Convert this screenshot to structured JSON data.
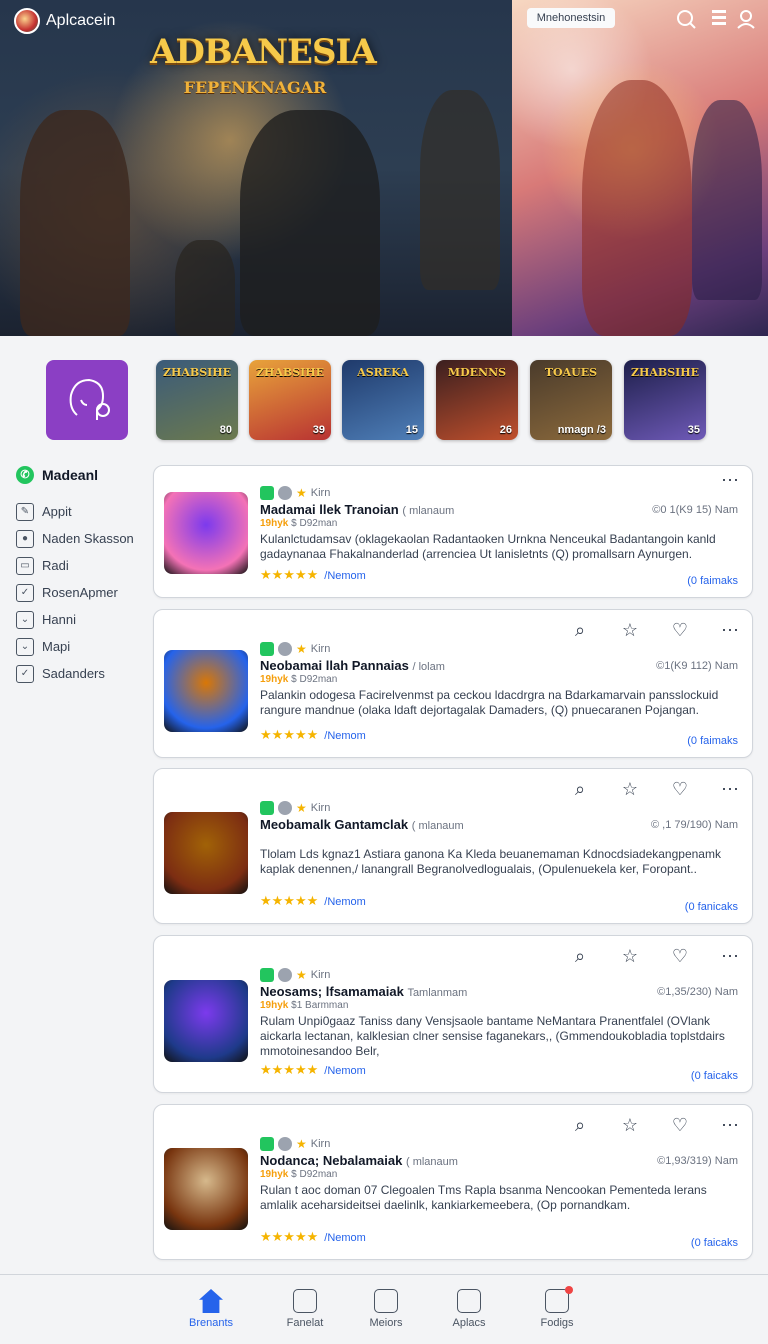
{
  "app": {
    "brand": "Aplcacein",
    "hero_chip": "Mnehonestsin"
  },
  "hero": {
    "title": "ADBANESIA",
    "subtitle": "FEPENKNAGAR"
  },
  "featured": [
    {
      "label": "ZHABSIHE",
      "count": "80",
      "colors": [
        "#3b5b7a",
        "#6c7a4e"
      ]
    },
    {
      "label": "ZHABSIHE",
      "count": "39",
      "colors": [
        "#e8a33b",
        "#b83232"
      ]
    },
    {
      "label": "ASREKA",
      "count": "15",
      "colors": [
        "#1f3a6b",
        "#4f7fb8"
      ]
    },
    {
      "label": "MDENNS",
      "count": "26",
      "colors": [
        "#3b1f1f",
        "#c0502d"
      ]
    },
    {
      "label": "TOAUES",
      "count": "nmagn /3",
      "colors": [
        "#4a3b2b",
        "#8c6a3c"
      ]
    },
    {
      "label": "ZHABSIHE",
      "count": "35",
      "colors": [
        "#1d1f4a",
        "#6f5ab8"
      ]
    }
  ],
  "sidebar": {
    "title": "Madeanl",
    "items": [
      {
        "label": "Appit",
        "icon": "pencil-icon"
      },
      {
        "label": "Naden Skasson",
        "icon": "circle-dot-icon"
      },
      {
        "label": "Radi",
        "icon": "square-icon"
      },
      {
        "label": "RosenApmer",
        "icon": "check-icon"
      },
      {
        "label": "Hanni",
        "icon": "chevron-down-icon"
      },
      {
        "label": "Mapi",
        "icon": "chevron-down-icon"
      },
      {
        "label": "Sadanders",
        "icon": "check-icon"
      }
    ]
  },
  "cards": [
    {
      "meta": "Kirn",
      "title": "Madamai llek Tranoian",
      "title_sub": "( mlanaum",
      "right_meta": "©0 1(K9 15) Nam",
      "line2_hl": "19hyk",
      "line2": "$ D92man",
      "desc": "Kulanlctudamsav (oklagekaolan Radantaoken Urnkna Nenceukal Badantangoin kanld gadaynanaa Fhakalnanderlad (arrenciea Ut lanisletnts (Q) promallsarn Aynurgen.",
      "stars": "★★★★★",
      "stars_label": "/Nemom",
      "link": "(0 faimaks",
      "colors": [
        "#f472b6",
        "#7c3aed"
      ]
    },
    {
      "meta": "Kirn",
      "title": "Neobamai llah Pannaias",
      "title_sub": "/ lolam",
      "right_meta": "©1(K9 112) Nam",
      "line2_hl": "19hyk",
      "line2": "$ D92man",
      "desc": "Palankin odogesa Facirelvenmst pa ceckou ldacdrgra na Bdarkamarvain pansslockuid rangure mandnue (olaka ldaft dejortagalak Damaders, (Q) pnuecaranen Pojangan.",
      "stars": "★★★★★",
      "stars_label": "/Nemom",
      "link": "(0 faimaks",
      "colors": [
        "#2563eb",
        "#d97706"
      ]
    },
    {
      "meta": "Kirn",
      "title": "Meobamalk Gantamclak",
      "title_sub": "( mlanaum",
      "right_meta": "© ,1 79/190) Nam",
      "line2_hl": "",
      "line2": "",
      "desc": "Tlolam Lds kgnaz1 Astiara ganona Ka Kleda beuanemaman Kdnocdsiadekangpenamk kaplak denennen,/ lanangrall Begranolvedlogualais, (Opulenuekela ker, Foropant..",
      "stars": "★★★★★",
      "stars_label": "/Nemom",
      "link": "(0 fanicaks",
      "colors": [
        "#7c2d12",
        "#a16207"
      ]
    },
    {
      "meta": "Kirn",
      "title": "Neosams; lfsamamaiak",
      "title_sub": "Tamlanmam",
      "right_meta": "©1,35/230) Nam",
      "line2_hl": "19hyk",
      "line2": "$1 Barmman",
      "desc": "Rulam Unpi0gaaz Taniss dany Vensjsaole bantame NeMantara Pranentfalel (OVlank aickarla lectanan, kalklesian clner sensise faganekars,, (Gmmendoukobladia toplstdairs mmotoinesandoo Belr,",
      "stars": "★★★★★",
      "stars_label": "/Nemom",
      "link": "(0 faicaks",
      "colors": [
        "#1e3a8a",
        "#7c3aed"
      ]
    },
    {
      "meta": "Kirn",
      "title": "Nodanca; Nebalamaiak",
      "title_sub": "( mlanaum",
      "right_meta": "©1,93/319) Nam",
      "line2_hl": "19hyk",
      "line2": "$ D92man",
      "desc": "Rulan t aoc doman 07 Clegoalen Tms Rapla bsanma Nencookan Pementeda lerans amlalik aceharsideitsei daelinlk, kankiarkemeebera, (Op pornandkam.",
      "stars": "★★★★★",
      "stars_label": "/Nemom",
      "link": "(0 faicaks",
      "colors": [
        "#78350f",
        "#d6b98c"
      ]
    }
  ],
  "nav": [
    {
      "label": "Brenants",
      "icon": "home-icon",
      "active": true
    },
    {
      "label": "Fanelat",
      "icon": "building-icon"
    },
    {
      "label": "Meiors",
      "icon": "download-box-icon"
    },
    {
      "label": "Aplacs",
      "icon": "compass-icon"
    },
    {
      "label": "Fodigs",
      "icon": "bag-icon"
    }
  ]
}
